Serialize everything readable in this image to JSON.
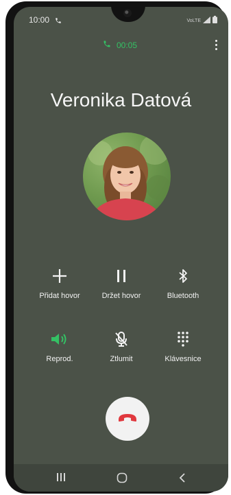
{
  "status_bar": {
    "time": "10:00",
    "volte_label": "VoLTE"
  },
  "call": {
    "timer": "00:05",
    "contact_name": "Veronika Datová"
  },
  "controls": {
    "add_call": "Přidat hovor",
    "hold_call": "Držet hovor",
    "bluetooth": "Bluetooth",
    "speaker": "Reprod.",
    "mute": "Ztlumit",
    "keypad": "Klávesnice"
  },
  "colors": {
    "accent_green": "#34c164",
    "end_call_red": "#e0383e",
    "background": "#4b5248"
  },
  "icons": {
    "timer": "phone-icon",
    "add_call": "plus-icon",
    "hold_call": "pause-icon",
    "bluetooth": "bluetooth-icon",
    "speaker": "speaker-icon",
    "mute": "mic-off-icon",
    "keypad": "keypad-icon",
    "end_call": "phone-hangup-icon"
  }
}
